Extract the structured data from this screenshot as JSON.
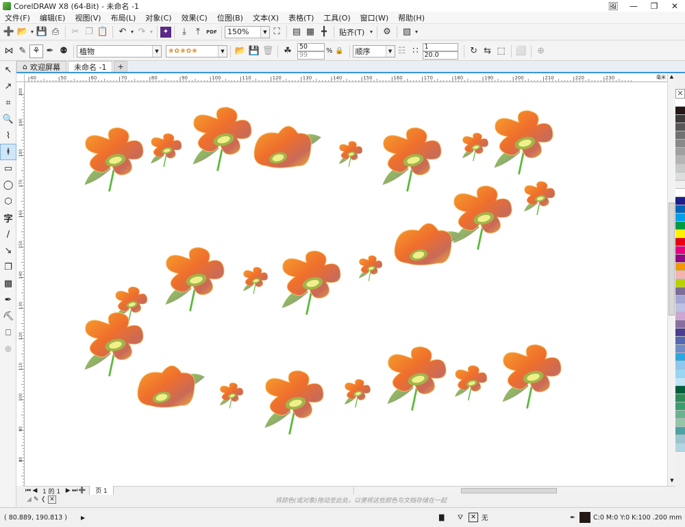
{
  "window": {
    "title": "CorelDRAW X8 (64-Bit) - 未命名 -1"
  },
  "menu": [
    "文件(F)",
    "编辑(E)",
    "视图(V)",
    "布局(L)",
    "对象(C)",
    "效果(C)",
    "位图(B)",
    "文本(X)",
    "表格(T)",
    "工具(O)",
    "窗口(W)",
    "帮助(H)"
  ],
  "toolbar1": {
    "zoom": "150%",
    "snap": "贴齐(T)",
    "pdf": "PDF"
  },
  "toolbar2": {
    "category": "植物",
    "width_pct": "50",
    "size_pct": "99",
    "pct_sign": "%",
    "order": "顺序",
    "count": "1",
    "spacing": "20.0"
  },
  "tabs": [
    {
      "label": "欢迎屏幕"
    },
    {
      "label": "未命名 -1",
      "active": true
    }
  ],
  "ruler": {
    "units": "毫米",
    "h_ticks": [
      "40",
      "50",
      "60",
      "70",
      "80",
      "90",
      "100",
      "110",
      "120",
      "130",
      "140",
      "150",
      "160",
      "170",
      "180",
      "190",
      "200",
      "210",
      "220",
      "230"
    ],
    "v_ticks": [
      "200",
      "190",
      "180",
      "170",
      "160",
      "150",
      "140",
      "130",
      "120",
      "110",
      "100",
      "90",
      "80"
    ]
  },
  "page_nav": {
    "page_text": "1 的 1",
    "page_tab": "页 1"
  },
  "hint": "将颜色(或对象)拖动至此处，以便将这些颜色与文档存储在一起",
  "status": {
    "coords": "( 80.889, 190.813 )",
    "fill_label": "无",
    "color_info": "C:0 M:0 Y:0 K:100  .200 mm"
  },
  "colors": {
    "accent": "#3c96d6",
    "petal": "#f47a2c",
    "leaf": "#7ec850"
  },
  "palette": [
    "#ffffff",
    "#231815",
    "#3e3a39",
    "#595757",
    "#727171",
    "#898989",
    "#9fa0a0",
    "#b5b5b6",
    "#c9caca",
    "#dcdddd",
    "#efefef",
    "#ffffff",
    "#1d2088",
    "#0068b7",
    "#00a0e9",
    "#009944",
    "#fff100",
    "#e60012",
    "#e4007f",
    "#920783",
    "#f39800",
    "#f5b2b2",
    "#b8d200",
    "#7d6d9b",
    "#a3a7d2",
    "#bcc2e3",
    "#c9a7d0",
    "#8a6f9e",
    "#4c3d8f",
    "#5469b1",
    "#6e8dc6",
    "#2ea7e0",
    "#8ec8ec",
    "#99d6f3",
    "#c0e4f6",
    "#005e3c",
    "#2e8b57",
    "#3a9d6f",
    "#6bb291",
    "#8fc7a8",
    "#4da3a3",
    "#9bc6cf",
    "#b1d7e2"
  ]
}
